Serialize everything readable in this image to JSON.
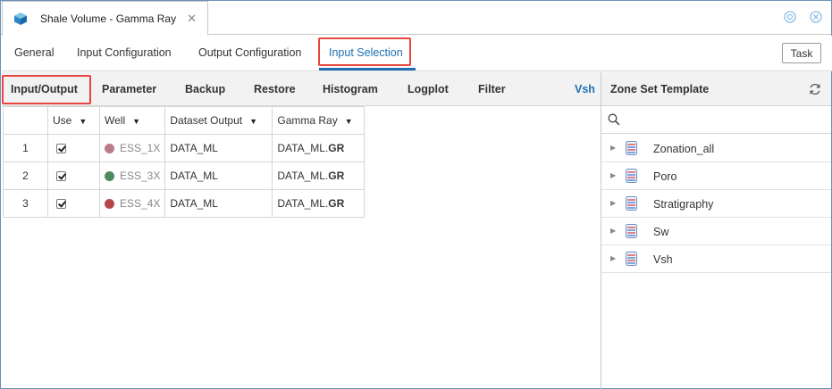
{
  "window": {
    "doc_tab_title": "Shale Volume - Gamma Ray"
  },
  "tabs": [
    {
      "label": "General"
    },
    {
      "label": "Input Configuration"
    },
    {
      "label": "Output Configuration"
    },
    {
      "label": "Input Selection",
      "active": true
    }
  ],
  "task_button": "Task",
  "toolbar": [
    {
      "label": "Input/Output"
    },
    {
      "label": "Parameter"
    },
    {
      "label": "Backup"
    },
    {
      "label": "Restore"
    },
    {
      "label": "Histogram"
    },
    {
      "label": "Logplot"
    },
    {
      "label": "Filter"
    },
    {
      "label": "Vsh"
    }
  ],
  "table": {
    "columns": [
      "",
      "Use",
      "Well",
      "Dataset Output",
      "Gamma Ray"
    ],
    "rows": [
      {
        "num": "1",
        "use": true,
        "well": "ESS_1X",
        "well_color": "#b87c8a",
        "dataset": "DATA_ML",
        "gr_prefix": "DATA_ML.",
        "gr_suffix": "GR"
      },
      {
        "num": "2",
        "use": true,
        "well": "ESS_3X",
        "well_color": "#4f8a5e",
        "dataset": "DATA_ML",
        "gr_prefix": "DATA_ML.",
        "gr_suffix": "GR"
      },
      {
        "num": "3",
        "use": true,
        "well": "ESS_4X",
        "well_color": "#b5474c",
        "dataset": "DATA_ML",
        "gr_prefix": "DATA_ML.",
        "gr_suffix": "GR"
      }
    ]
  },
  "zone_panel": {
    "title": "Zone Set Template",
    "search_placeholder": "",
    "items": [
      {
        "label": "Zonation_all"
      },
      {
        "label": "Poro"
      },
      {
        "label": "Stratigraphy"
      },
      {
        "label": "Sw"
      },
      {
        "label": "Vsh"
      }
    ]
  },
  "colors": {
    "accent": "#1f6fb5",
    "highlight": "#e64540"
  }
}
